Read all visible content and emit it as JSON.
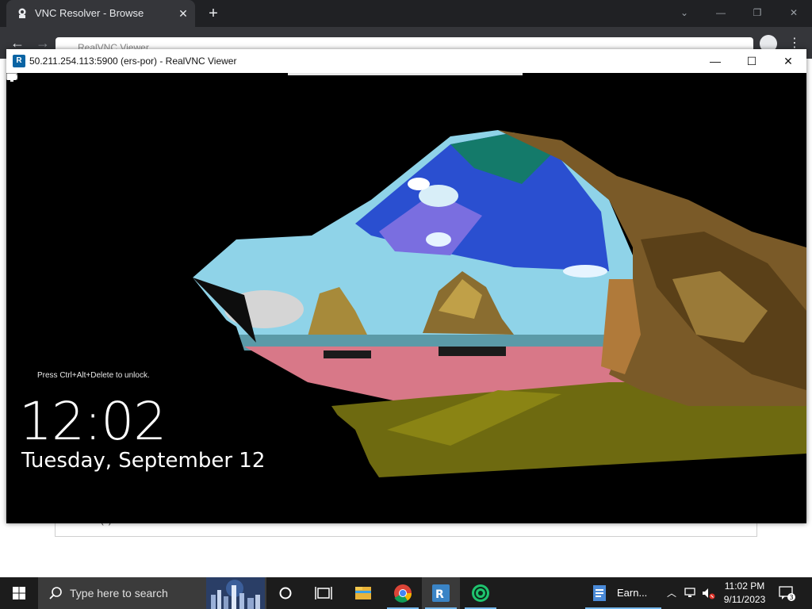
{
  "browser": {
    "tab_title": "VNC Resolver - Browse",
    "new_tab_glyph": "+",
    "close_glyph": "✕",
    "back_glyph": "←",
    "forward_glyph": "→",
    "omnibox_ghost_title": "RealVNC Viewer",
    "window_controls": {
      "minimize": "—",
      "restore": "❐",
      "close": "✕",
      "dropdown": "⌄"
    }
  },
  "page": {
    "devices_text": "2 device(s)"
  },
  "vnc": {
    "window_title": "50.211.254.113:5900 (ers-por) - RealVNC Viewer",
    "controls": {
      "minimize": "—",
      "maximize": "☐",
      "close": "✕"
    },
    "lock_screen": {
      "hint": "Press Ctrl+Alt+Delete to unlock.",
      "time": "12:02",
      "date": "Tuesday, September 12"
    }
  },
  "taskbar": {
    "search_placeholder": "Type here to search",
    "pinned_app_label": "Earn...",
    "clock_time": "11:02 PM",
    "clock_date": "9/11/2023",
    "notification_count": "3",
    "icons": [
      "windows-start-icon",
      "search-icon",
      "cortana-icon",
      "task-view-icon",
      "file-explorer-icon",
      "chrome-icon",
      "realvnc-icon",
      "green-app-icon",
      "document-icon",
      "chevron-up-icon",
      "network-icon",
      "volume-muted-icon",
      "notification-icon"
    ]
  },
  "colors": {
    "chrome_dark": "#202124",
    "chrome_tab": "#35363a",
    "taskbar": "#1c1c1c",
    "accent": "#76b9ed",
    "vnc_blue": "#0a64a4"
  }
}
